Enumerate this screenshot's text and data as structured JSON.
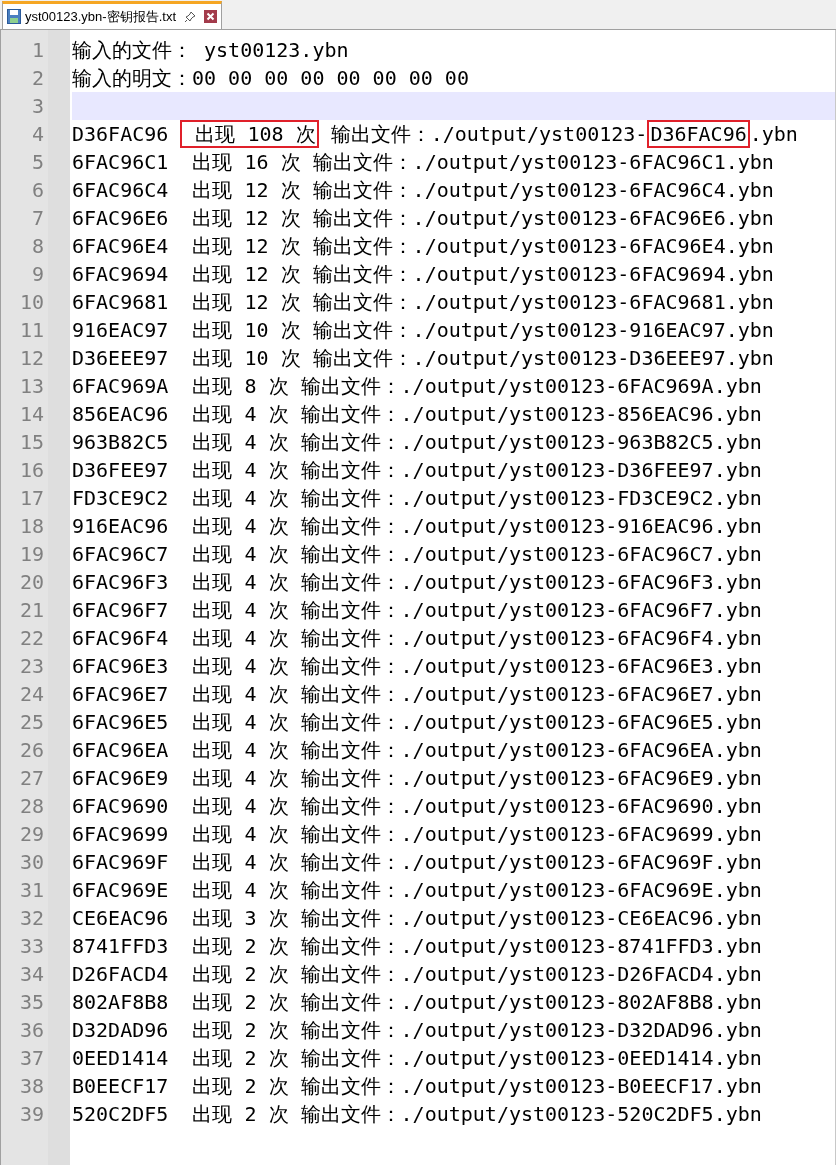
{
  "tab": {
    "title": "yst00123.ybn-密钥报告.txt",
    "selected": true
  },
  "lines": [
    {
      "number": "1",
      "text": "输入的文件： yst00123.ybn",
      "current": false
    },
    {
      "number": "2",
      "text": "输入的明文：00 00 00 00 00 00 00 00",
      "current": false
    },
    {
      "number": "3",
      "current": true
    },
    {
      "number": "4",
      "current": false,
      "parts": [
        {
          "text": "D36FAC96 ",
          "boxed": false
        },
        {
          "text": " 出现 108 次",
          "boxed": true
        },
        {
          "text": " 输出文件：./output/yst00123-",
          "boxed": false
        },
        {
          "text": "D36FAC96",
          "boxed": true
        },
        {
          "text": ".ybn",
          "boxed": false
        }
      ]
    },
    {
      "number": "5",
      "text": "6FAC96C1  出现 16 次 输出文件：./output/yst00123-6FAC96C1.ybn",
      "current": false
    },
    {
      "number": "6",
      "text": "6FAC96C4  出现 12 次 输出文件：./output/yst00123-6FAC96C4.ybn",
      "current": false
    },
    {
      "number": "7",
      "text": "6FAC96E6  出现 12 次 输出文件：./output/yst00123-6FAC96E6.ybn",
      "current": false
    },
    {
      "number": "8",
      "text": "6FAC96E4  出现 12 次 输出文件：./output/yst00123-6FAC96E4.ybn",
      "current": false
    },
    {
      "number": "9",
      "text": "6FAC9694  出现 12 次 输出文件：./output/yst00123-6FAC9694.ybn",
      "current": false
    },
    {
      "number": "10",
      "text": "6FAC9681  出现 12 次 输出文件：./output/yst00123-6FAC9681.ybn",
      "current": false
    },
    {
      "number": "11",
      "text": "916EAC97  出现 10 次 输出文件：./output/yst00123-916EAC97.ybn",
      "current": false
    },
    {
      "number": "12",
      "text": "D36EEE97  出现 10 次 输出文件：./output/yst00123-D36EEE97.ybn",
      "current": false
    },
    {
      "number": "13",
      "text": "6FAC969A  出现 8 次 输出文件：./output/yst00123-6FAC969A.ybn",
      "current": false
    },
    {
      "number": "14",
      "text": "856EAC96  出现 4 次 输出文件：./output/yst00123-856EAC96.ybn",
      "current": false
    },
    {
      "number": "15",
      "text": "963B82C5  出现 4 次 输出文件：./output/yst00123-963B82C5.ybn",
      "current": false
    },
    {
      "number": "16",
      "text": "D36FEE97  出现 4 次 输出文件：./output/yst00123-D36FEE97.ybn",
      "current": false
    },
    {
      "number": "17",
      "text": "FD3CE9C2  出现 4 次 输出文件：./output/yst00123-FD3CE9C2.ybn",
      "current": false
    },
    {
      "number": "18",
      "text": "916EAC96  出现 4 次 输出文件：./output/yst00123-916EAC96.ybn",
      "current": false
    },
    {
      "number": "19",
      "text": "6FAC96C7  出现 4 次 输出文件：./output/yst00123-6FAC96C7.ybn",
      "current": false
    },
    {
      "number": "20",
      "text": "6FAC96F3  出现 4 次 输出文件：./output/yst00123-6FAC96F3.ybn",
      "current": false
    },
    {
      "number": "21",
      "text": "6FAC96F7  出现 4 次 输出文件：./output/yst00123-6FAC96F7.ybn",
      "current": false
    },
    {
      "number": "22",
      "text": "6FAC96F4  出现 4 次 输出文件：./output/yst00123-6FAC96F4.ybn",
      "current": false
    },
    {
      "number": "23",
      "text": "6FAC96E3  出现 4 次 输出文件：./output/yst00123-6FAC96E3.ybn",
      "current": false
    },
    {
      "number": "24",
      "text": "6FAC96E7  出现 4 次 输出文件：./output/yst00123-6FAC96E7.ybn",
      "current": false
    },
    {
      "number": "25",
      "text": "6FAC96E5  出现 4 次 输出文件：./output/yst00123-6FAC96E5.ybn",
      "current": false
    },
    {
      "number": "26",
      "text": "6FAC96EA  出现 4 次 输出文件：./output/yst00123-6FAC96EA.ybn",
      "current": false
    },
    {
      "number": "27",
      "text": "6FAC96E9  出现 4 次 输出文件：./output/yst00123-6FAC96E9.ybn",
      "current": false
    },
    {
      "number": "28",
      "text": "6FAC9690  出现 4 次 输出文件：./output/yst00123-6FAC9690.ybn",
      "current": false
    },
    {
      "number": "29",
      "text": "6FAC9699  出现 4 次 输出文件：./output/yst00123-6FAC9699.ybn",
      "current": false
    },
    {
      "number": "30",
      "text": "6FAC969F  出现 4 次 输出文件：./output/yst00123-6FAC969F.ybn",
      "current": false
    },
    {
      "number": "31",
      "text": "6FAC969E  出现 4 次 输出文件：./output/yst00123-6FAC969E.ybn",
      "current": false
    },
    {
      "number": "32",
      "text": "CE6EAC96  出现 3 次 输出文件：./output/yst00123-CE6EAC96.ybn",
      "current": false
    },
    {
      "number": "33",
      "text": "8741FFD3  出现 2 次 输出文件：./output/yst00123-8741FFD3.ybn",
      "current": false
    },
    {
      "number": "34",
      "text": "D26FACD4  出现 2 次 输出文件：./output/yst00123-D26FACD4.ybn",
      "current": false
    },
    {
      "number": "35",
      "text": "802AF8B8  出现 2 次 输出文件：./output/yst00123-802AF8B8.ybn",
      "current": false
    },
    {
      "number": "36",
      "text": "D32DAD96  出现 2 次 输出文件：./output/yst00123-D32DAD96.ybn",
      "current": false
    },
    {
      "number": "37",
      "text": "0EED1414  出现 2 次 输出文件：./output/yst00123-0EED1414.ybn",
      "current": false
    },
    {
      "number": "38",
      "text": "B0EECF17  出现 2 次 输出文件：./output/yst00123-B0EECF17.ybn",
      "current": false
    },
    {
      "number": "39",
      "text": "520C2DF5  出现 2 次 输出文件：./output/yst00123-520C2DF5.ybn",
      "current": false
    }
  ]
}
